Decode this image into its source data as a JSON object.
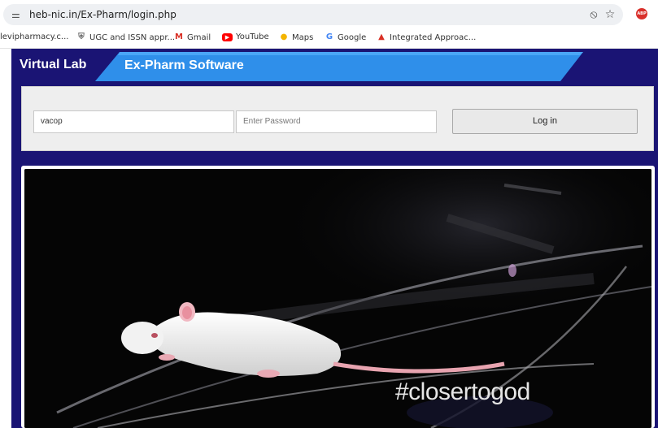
{
  "browser": {
    "url": "heb-nic.in/Ex-Pharm/login.php",
    "site_info_icon": "site-settings-icon",
    "actions": [
      {
        "name": "no-location-icon",
        "glyph": "⦸"
      },
      {
        "name": "star-icon",
        "glyph": "☆"
      },
      {
        "name": "adblock-plus-icon",
        "glyph": "ABP"
      }
    ]
  },
  "bookmarks": [
    {
      "label": "levipharmacy.c...",
      "icon": "",
      "icon_name": "",
      "color": "#333333"
    },
    {
      "label": "UGC and ISSN appr...",
      "icon": "⛨",
      "icon_name": "ugc-shield-icon",
      "color": "#666666"
    },
    {
      "label": "Gmail",
      "icon": "M",
      "icon_name": "gmail-icon",
      "color": "#d93025"
    },
    {
      "label": "YouTube",
      "icon": "▶",
      "icon_name": "youtube-icon",
      "color": "#ff0000"
    },
    {
      "label": "Maps",
      "icon": "●",
      "icon_name": "maps-icon",
      "color": "#f4b400"
    },
    {
      "label": "Google",
      "icon": "G",
      "icon_name": "google-icon",
      "color": "#4285f4"
    },
    {
      "label": "Integrated Approac...",
      "icon": "▲",
      "icon_name": "integrated-approach-icon",
      "color": "#d93025"
    }
  ],
  "header": {
    "title": "Virtual Lab",
    "subtitle": "Ex-Pharm Software"
  },
  "login": {
    "username_value": "vacop",
    "password_placeholder": "Enter Password",
    "submit_label": "Log in"
  },
  "video": {
    "overlay_text": "#closertogod"
  },
  "colors": {
    "page_bg": "#1a1474",
    "band_blue": "#2f8fea",
    "panel_bg": "#eeeeee"
  }
}
